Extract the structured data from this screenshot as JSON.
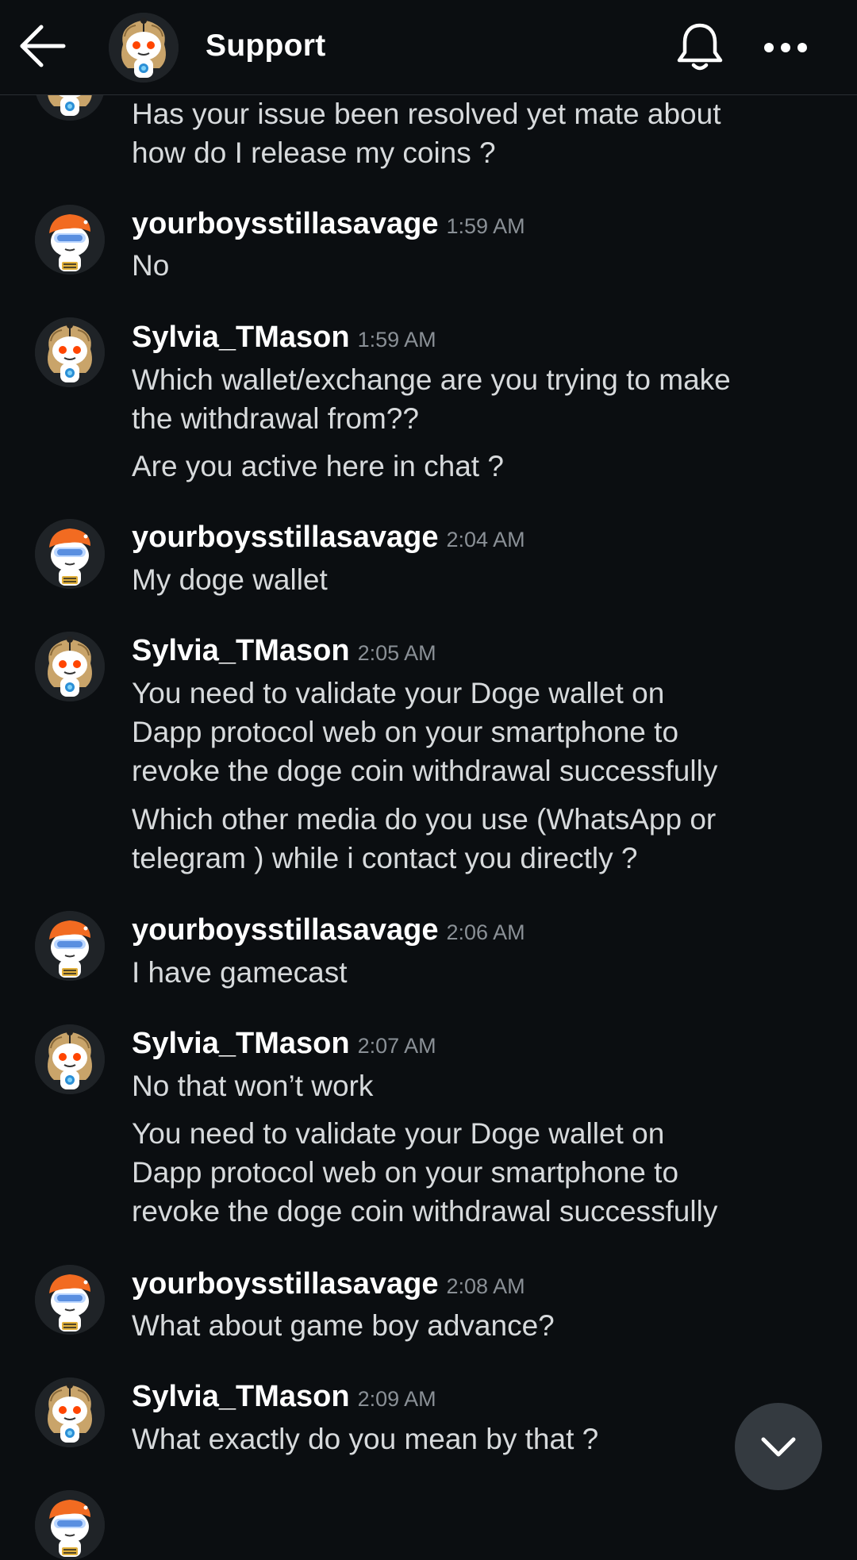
{
  "header": {
    "title": "Support",
    "back_icon": "arrow-left-icon",
    "notification_icon": "bell-icon",
    "more_icon": "more-horizontal-icon"
  },
  "messages": [
    {
      "id": "m0",
      "continuation": true,
      "texts": [
        "Has your issue been resolved yet mate about\nhow do I release my coins ?"
      ]
    },
    {
      "id": "m1",
      "user": "yourboysstillasavage",
      "time": "1:59 AM",
      "texts": [
        "No"
      ]
    },
    {
      "id": "m2",
      "user": "Sylvia_TMason",
      "time": "1:59 AM",
      "texts": [
        "Which wallet/exchange are you trying to make\nthe withdrawal from??",
        "Are you active here in chat ?"
      ]
    },
    {
      "id": "m3",
      "user": "yourboysstillasavage",
      "time": "2:04 AM",
      "texts": [
        "My doge wallet"
      ]
    },
    {
      "id": "m4",
      "user": "Sylvia_TMason",
      "time": "2:05 AM",
      "texts": [
        "You need to validate your Doge wallet on\nDapp protocol web on your smartphone to\nrevoke the doge coin withdrawal successfully",
        "Which other media do you use (WhatsApp or\ntelegram ) while i contact you directly ?"
      ]
    },
    {
      "id": "m5",
      "user": "yourboysstillasavage",
      "time": "2:06 AM",
      "texts": [
        "I have gamecast"
      ]
    },
    {
      "id": "m6",
      "user": "Sylvia_TMason",
      "time": "2:07 AM",
      "texts": [
        "No that won’t work",
        "You need to validate your Doge wallet on\nDapp protocol web on your smartphone to\nrevoke the doge coin withdrawal successfully"
      ]
    },
    {
      "id": "m7",
      "user": "yourboysstillasavage",
      "time": "2:08 AM",
      "texts": [
        "What about game boy advance?"
      ]
    },
    {
      "id": "m8",
      "user": "Sylvia_TMason",
      "time": "2:09 AM",
      "texts": [
        "What exactly do you mean by that ?"
      ]
    }
  ],
  "scroll_button": {
    "icon": "chevron-down-icon"
  },
  "colors": {
    "background": "#0b0e11",
    "text": "#d7dadc",
    "username": "#ffffff",
    "timestamp": "#8a9096",
    "fab": "#343a40"
  }
}
